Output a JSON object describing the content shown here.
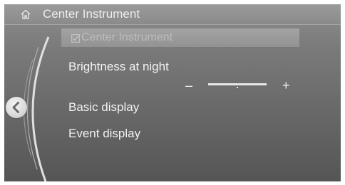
{
  "header": {
    "title": "Center Instrument",
    "home_icon": "home-icon"
  },
  "subheader": {
    "label": "Center Instrument",
    "checkbox_icon": "checkbox-icon"
  },
  "menu": {
    "items": [
      {
        "label": "Brightness at night"
      },
      {
        "label": "Basic display"
      },
      {
        "label": "Event display"
      }
    ]
  },
  "brightness_slider": {
    "minus_label": "–",
    "plus_label": "+"
  },
  "navigation": {
    "back_icon": "chevron-left-icon"
  },
  "colors": {
    "background": "#7a7a7a",
    "header": "#8a8a8a",
    "text": "#f2f2f2",
    "dim_text": "#bdbdbd"
  }
}
